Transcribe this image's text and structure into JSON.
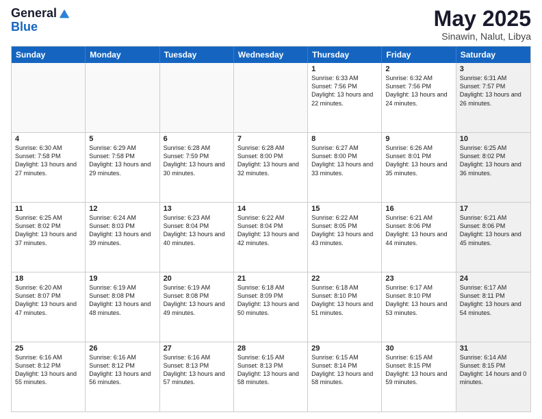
{
  "header": {
    "logo_line1": "General",
    "logo_line2": "Blue",
    "month": "May 2025",
    "location": "Sinawin, Nalut, Libya"
  },
  "weekdays": [
    "Sunday",
    "Monday",
    "Tuesday",
    "Wednesday",
    "Thursday",
    "Friday",
    "Saturday"
  ],
  "weeks": [
    [
      {
        "day": "",
        "sunrise": "",
        "sunset": "",
        "daylight": "",
        "empty": true
      },
      {
        "day": "",
        "sunrise": "",
        "sunset": "",
        "daylight": "",
        "empty": true
      },
      {
        "day": "",
        "sunrise": "",
        "sunset": "",
        "daylight": "",
        "empty": true
      },
      {
        "day": "",
        "sunrise": "",
        "sunset": "",
        "daylight": "",
        "empty": true
      },
      {
        "day": "1",
        "sunrise": "Sunrise: 6:33 AM",
        "sunset": "Sunset: 7:56 PM",
        "daylight": "Daylight: 13 hours and 22 minutes.",
        "empty": false
      },
      {
        "day": "2",
        "sunrise": "Sunrise: 6:32 AM",
        "sunset": "Sunset: 7:56 PM",
        "daylight": "Daylight: 13 hours and 24 minutes.",
        "empty": false
      },
      {
        "day": "3",
        "sunrise": "Sunrise: 6:31 AM",
        "sunset": "Sunset: 7:57 PM",
        "daylight": "Daylight: 13 hours and 26 minutes.",
        "empty": false,
        "shaded": true
      }
    ],
    [
      {
        "day": "4",
        "sunrise": "Sunrise: 6:30 AM",
        "sunset": "Sunset: 7:58 PM",
        "daylight": "Daylight: 13 hours and 27 minutes.",
        "empty": false
      },
      {
        "day": "5",
        "sunrise": "Sunrise: 6:29 AM",
        "sunset": "Sunset: 7:58 PM",
        "daylight": "Daylight: 13 hours and 29 minutes.",
        "empty": false
      },
      {
        "day": "6",
        "sunrise": "Sunrise: 6:28 AM",
        "sunset": "Sunset: 7:59 PM",
        "daylight": "Daylight: 13 hours and 30 minutes.",
        "empty": false
      },
      {
        "day": "7",
        "sunrise": "Sunrise: 6:28 AM",
        "sunset": "Sunset: 8:00 PM",
        "daylight": "Daylight: 13 hours and 32 minutes.",
        "empty": false
      },
      {
        "day": "8",
        "sunrise": "Sunrise: 6:27 AM",
        "sunset": "Sunset: 8:00 PM",
        "daylight": "Daylight: 13 hours and 33 minutes.",
        "empty": false
      },
      {
        "day": "9",
        "sunrise": "Sunrise: 6:26 AM",
        "sunset": "Sunset: 8:01 PM",
        "daylight": "Daylight: 13 hours and 35 minutes.",
        "empty": false
      },
      {
        "day": "10",
        "sunrise": "Sunrise: 6:25 AM",
        "sunset": "Sunset: 8:02 PM",
        "daylight": "Daylight: 13 hours and 36 minutes.",
        "empty": false,
        "shaded": true
      }
    ],
    [
      {
        "day": "11",
        "sunrise": "Sunrise: 6:25 AM",
        "sunset": "Sunset: 8:02 PM",
        "daylight": "Daylight: 13 hours and 37 minutes.",
        "empty": false
      },
      {
        "day": "12",
        "sunrise": "Sunrise: 6:24 AM",
        "sunset": "Sunset: 8:03 PM",
        "daylight": "Daylight: 13 hours and 39 minutes.",
        "empty": false
      },
      {
        "day": "13",
        "sunrise": "Sunrise: 6:23 AM",
        "sunset": "Sunset: 8:04 PM",
        "daylight": "Daylight: 13 hours and 40 minutes.",
        "empty": false
      },
      {
        "day": "14",
        "sunrise": "Sunrise: 6:22 AM",
        "sunset": "Sunset: 8:04 PM",
        "daylight": "Daylight: 13 hours and 42 minutes.",
        "empty": false
      },
      {
        "day": "15",
        "sunrise": "Sunrise: 6:22 AM",
        "sunset": "Sunset: 8:05 PM",
        "daylight": "Daylight: 13 hours and 43 minutes.",
        "empty": false
      },
      {
        "day": "16",
        "sunrise": "Sunrise: 6:21 AM",
        "sunset": "Sunset: 8:06 PM",
        "daylight": "Daylight: 13 hours and 44 minutes.",
        "empty": false
      },
      {
        "day": "17",
        "sunrise": "Sunrise: 6:21 AM",
        "sunset": "Sunset: 8:06 PM",
        "daylight": "Daylight: 13 hours and 45 minutes.",
        "empty": false,
        "shaded": true
      }
    ],
    [
      {
        "day": "18",
        "sunrise": "Sunrise: 6:20 AM",
        "sunset": "Sunset: 8:07 PM",
        "daylight": "Daylight: 13 hours and 47 minutes.",
        "empty": false
      },
      {
        "day": "19",
        "sunrise": "Sunrise: 6:19 AM",
        "sunset": "Sunset: 8:08 PM",
        "daylight": "Daylight: 13 hours and 48 minutes.",
        "empty": false
      },
      {
        "day": "20",
        "sunrise": "Sunrise: 6:19 AM",
        "sunset": "Sunset: 8:08 PM",
        "daylight": "Daylight: 13 hours and 49 minutes.",
        "empty": false
      },
      {
        "day": "21",
        "sunrise": "Sunrise: 6:18 AM",
        "sunset": "Sunset: 8:09 PM",
        "daylight": "Daylight: 13 hours and 50 minutes.",
        "empty": false
      },
      {
        "day": "22",
        "sunrise": "Sunrise: 6:18 AM",
        "sunset": "Sunset: 8:10 PM",
        "daylight": "Daylight: 13 hours and 51 minutes.",
        "empty": false
      },
      {
        "day": "23",
        "sunrise": "Sunrise: 6:17 AM",
        "sunset": "Sunset: 8:10 PM",
        "daylight": "Daylight: 13 hours and 53 minutes.",
        "empty": false
      },
      {
        "day": "24",
        "sunrise": "Sunrise: 6:17 AM",
        "sunset": "Sunset: 8:11 PM",
        "daylight": "Daylight: 13 hours and 54 minutes.",
        "empty": false,
        "shaded": true
      }
    ],
    [
      {
        "day": "25",
        "sunrise": "Sunrise: 6:16 AM",
        "sunset": "Sunset: 8:12 PM",
        "daylight": "Daylight: 13 hours and 55 minutes.",
        "empty": false
      },
      {
        "day": "26",
        "sunrise": "Sunrise: 6:16 AM",
        "sunset": "Sunset: 8:12 PM",
        "daylight": "Daylight: 13 hours and 56 minutes.",
        "empty": false
      },
      {
        "day": "27",
        "sunrise": "Sunrise: 6:16 AM",
        "sunset": "Sunset: 8:13 PM",
        "daylight": "Daylight: 13 hours and 57 minutes.",
        "empty": false
      },
      {
        "day": "28",
        "sunrise": "Sunrise: 6:15 AM",
        "sunset": "Sunset: 8:13 PM",
        "daylight": "Daylight: 13 hours and 58 minutes.",
        "empty": false
      },
      {
        "day": "29",
        "sunrise": "Sunrise: 6:15 AM",
        "sunset": "Sunset: 8:14 PM",
        "daylight": "Daylight: 13 hours and 58 minutes.",
        "empty": false
      },
      {
        "day": "30",
        "sunrise": "Sunrise: 6:15 AM",
        "sunset": "Sunset: 8:15 PM",
        "daylight": "Daylight: 13 hours and 59 minutes.",
        "empty": false
      },
      {
        "day": "31",
        "sunrise": "Sunrise: 6:14 AM",
        "sunset": "Sunset: 8:15 PM",
        "daylight": "Daylight: 14 hours and 0 minutes.",
        "empty": false,
        "shaded": true
      }
    ]
  ]
}
